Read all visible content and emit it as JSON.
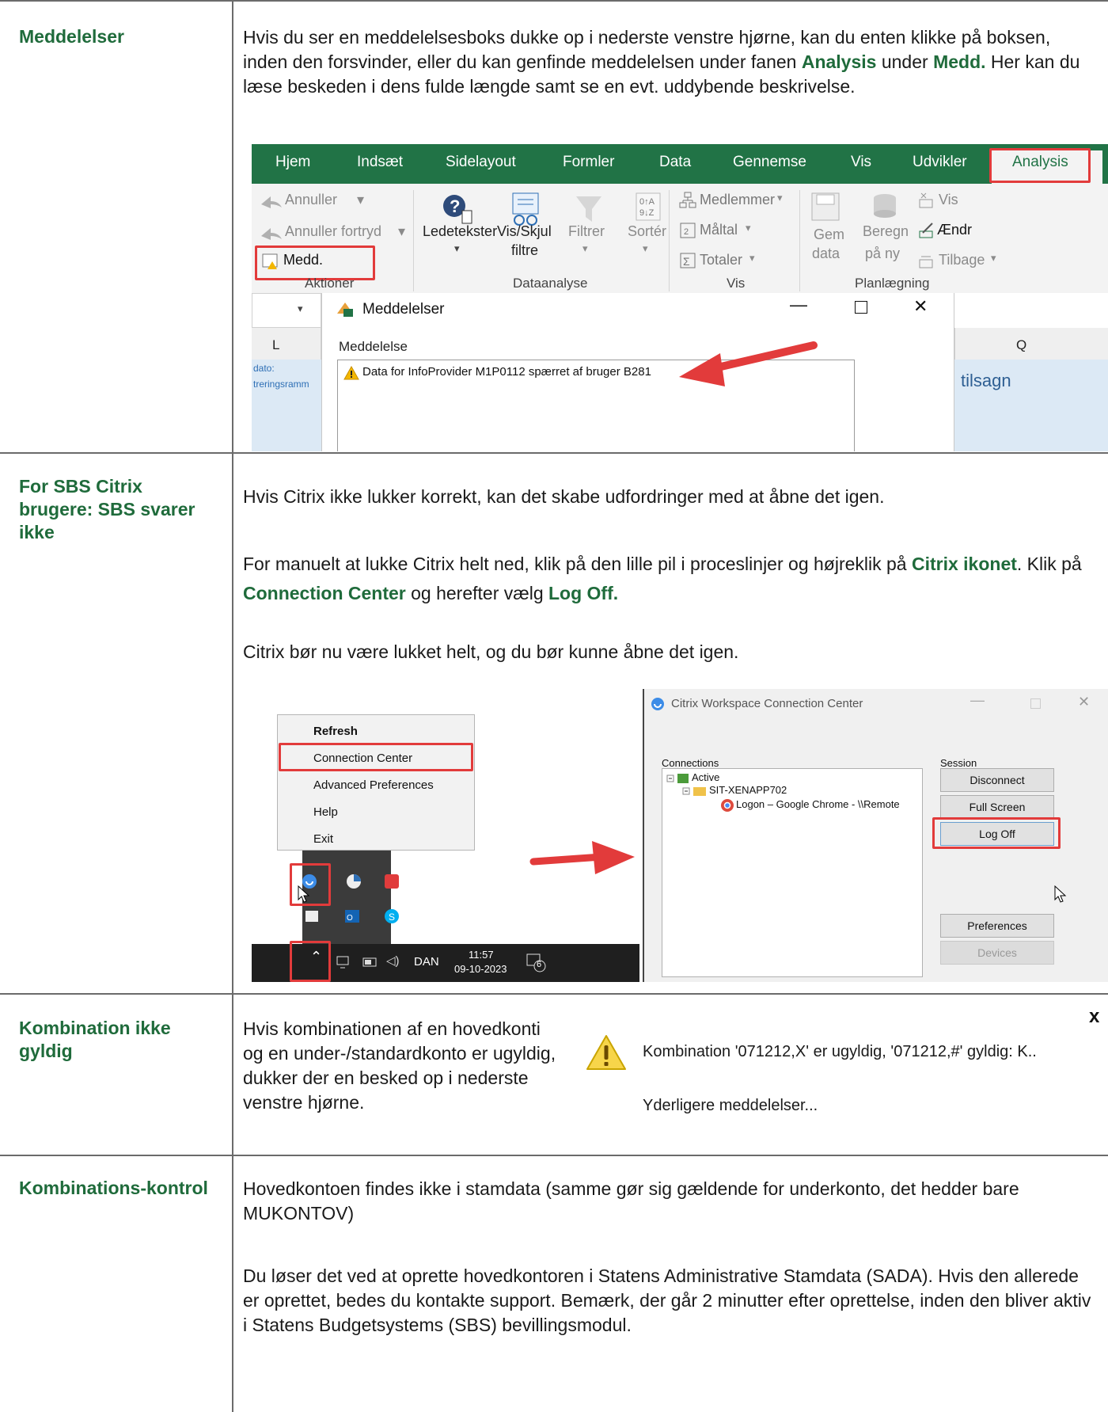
{
  "rows": [
    {
      "label": "Meddelelser",
      "text_parts": [
        "Hvis du ser en meddelelsesboks dukke op i nederste venstre hjørne, kan du enten klikke på boksen, inden den forsvinder, eller du kan genfinde meddelelsen under fanen ",
        "Analysis",
        " under ",
        "Medd.",
        " Her kan du læse beskeden i dens fulde længde samt se en evt. uddybende beskrivelse."
      ]
    },
    {
      "label": "For SBS Citrix brugere: SBS svarer ikke",
      "p1": "Hvis Citrix ikke lukker korrekt, kan det skabe udfordringer med at åbne det igen.",
      "p2_parts": [
        "For manuelt at lukke Citrix helt ned, klik på den lille pil i proceslinjer og højreklik på ",
        "Citrix ikonet",
        ". Klik på ",
        "Connection Center",
        " og herefter vælg ",
        "Log Off."
      ],
      "p3": "Citrix bør nu være lukket helt, og du bør kunne åbne det igen."
    },
    {
      "label": "Kombination ikke gyldig",
      "text": "Hvis kombinationen af en hovedkonti og en under-/standardkonto er ugyldig, dukker der en besked op i nederste venstre hjørne."
    },
    {
      "label": "Kombinations-kontrol",
      "p1": "Hovedkontoen findes ikke i stamdata (samme gør sig gældende for underkonto, det hedder bare MUKONTOV)",
      "p2": "Du løser det ved at oprette hovedkontoren i Statens Administrative Stamdata (SADA). Hvis den allerede er oprettet, bedes du kontakte support. Bemærk, der går 2 minutter efter oprettelse, inden den bliver aktiv i Statens Budgetsystems (SBS) bevillingsmodul."
    }
  ],
  "excel": {
    "tabs": [
      "Hjem",
      "Indsæt",
      "Sidelayout",
      "Formler",
      "Data",
      "Gennemse",
      "Vis",
      "Udvikler",
      "Analysis"
    ],
    "aktioner": {
      "annuller": "Annuller",
      "annuller_fortryd": "Annuller fortryd",
      "medd": "Medd.",
      "group": "Aktioner"
    },
    "dataanalyse": {
      "ledetekster": "Ledetekster",
      "vis_skjul": "Vis/Skjul",
      "filtre": "filtre",
      "filtrer": "Filtrer",
      "sorter": "Sortér",
      "group": "Dataanalyse"
    },
    "vis": {
      "medlemmer": "Medlemmer",
      "maltal": "Måltal",
      "totaler": "Totaler",
      "group": "Vis"
    },
    "planlaegning": {
      "gem": "Gem",
      "data": "data",
      "beregn": "Beregn",
      "pany": "på ny",
      "vis": "Vis",
      "aendr": "Ændr",
      "tilbage": "Tilbage",
      "group": "Planlægning"
    },
    "dialog": {
      "title": "Meddelelser",
      "column": "Meddelelse",
      "message": "Data for InfoProvider M1P0112 spærret af bruger B281"
    },
    "grid": {
      "col_l": "L",
      "col_q": "Q",
      "cell1": "dato:",
      "cell2": "treringsramm",
      "tilsagn": "tilsagn"
    }
  },
  "citrix": {
    "menu_items": [
      "Refresh",
      "Connection Center",
      "Advanced Preferences",
      "Help",
      "Exit"
    ],
    "taskbar": {
      "lang": "DAN",
      "time": "11:57",
      "date": "09-10-2023",
      "notif_count": "6"
    },
    "window_title": "Citrix Workspace Connection Center",
    "connections_label": "Connections",
    "tree": [
      "Active",
      "SIT-XENAPP702",
      "Logon – Google Chrome - \\\\Remote"
    ],
    "session_label": "Session",
    "buttons": [
      "Disconnect",
      "Full Screen",
      "Log Off",
      "Preferences",
      "Devices"
    ]
  },
  "popup": {
    "message": "Kombination '071212,X' er ugyldig, '071212,#' gyldig: K..",
    "more": "Yderligere meddelelser...",
    "close": "x"
  },
  "colors": {
    "label_green": "#1f6b3b",
    "excel_green": "#217346",
    "highlight_red": "#e23b3b"
  }
}
